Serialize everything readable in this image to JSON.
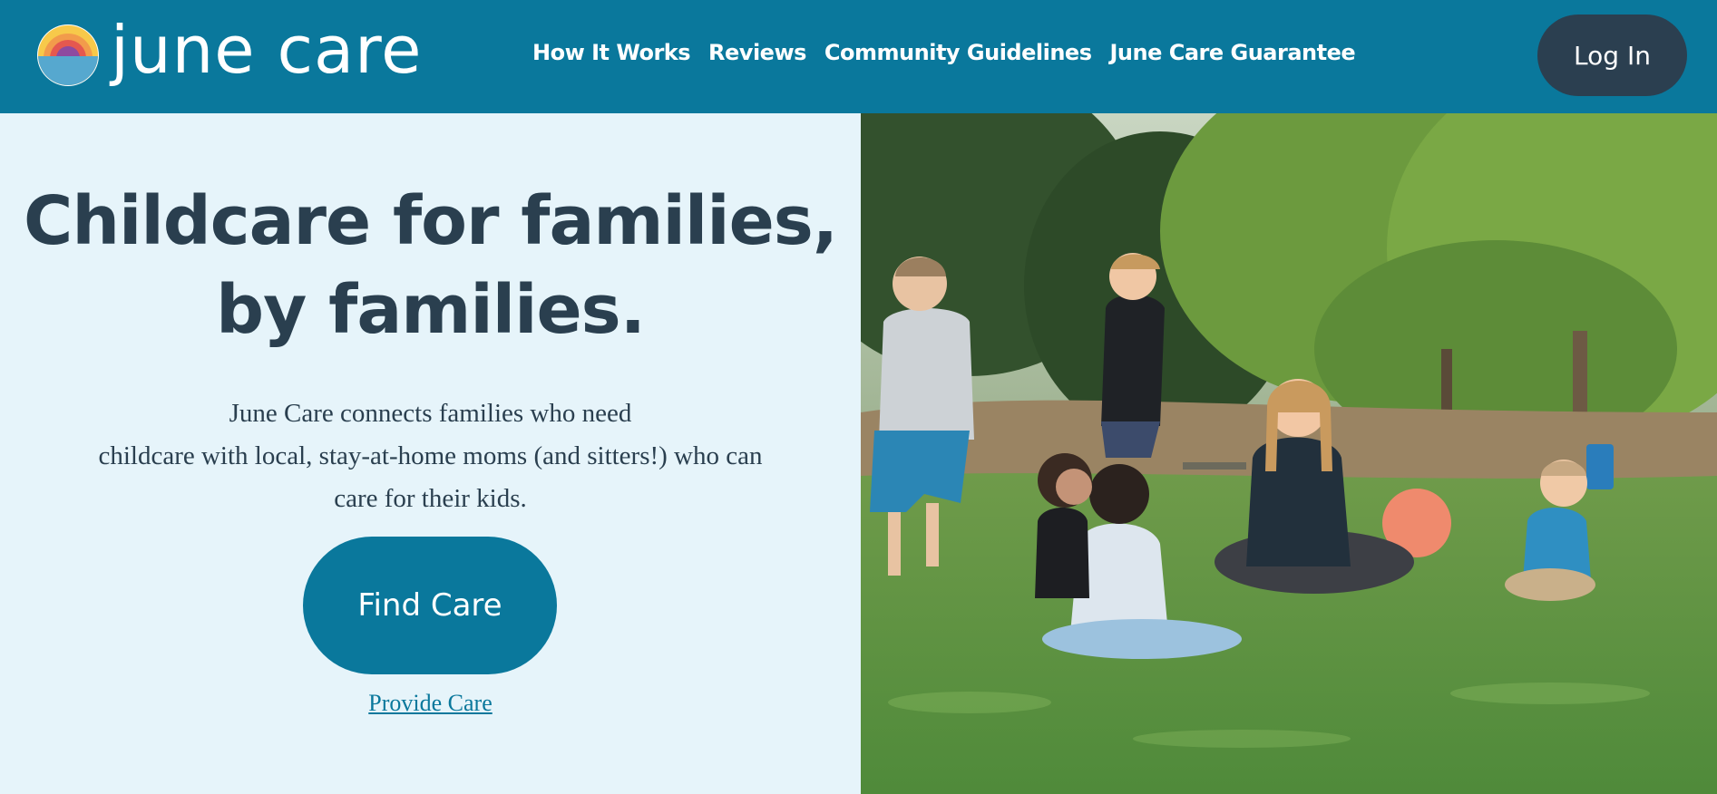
{
  "header": {
    "logo_text": "june care",
    "nav": [
      "How It Works",
      "Reviews",
      "Community Guidelines",
      "June Care Guarantee"
    ],
    "login_label": "Log In"
  },
  "hero": {
    "headline_line1": "Childcare for families,",
    "headline_line2": "by families.",
    "sub_line1": "June Care connects families who need",
    "sub_line2": "childcare with local, stay-at-home moms (and sitters!) who can",
    "sub_line3": "care for their kids.",
    "find_care_label": "Find Care",
    "provide_care_label": "Provide Care"
  },
  "colors": {
    "brand_blue": "#0a789c",
    "dark_navy": "#2b3f50",
    "hero_bg": "#e6f4fa"
  },
  "icons": {
    "logo": "sunset-logo-icon"
  }
}
